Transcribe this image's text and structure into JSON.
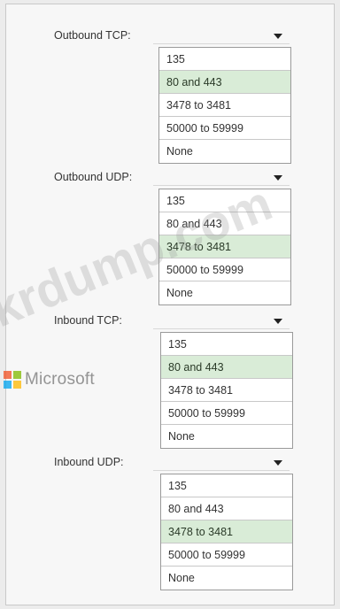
{
  "groups": [
    {
      "label": "Outbound TCP:",
      "options": [
        "135",
        "80 and 443",
        "3478 to 3481",
        "50000 to 59999",
        "None"
      ],
      "selected": "80 and 443"
    },
    {
      "label": "Outbound UDP:",
      "options": [
        "135",
        "80 and 443",
        "3478 to 3481",
        "50000 to 59999",
        "None"
      ],
      "selected": "3478 to 3481"
    },
    {
      "label": "Inbound TCP:",
      "options": [
        "135",
        "80 and 443",
        "3478 to 3481",
        "50000 to 59999",
        "None"
      ],
      "selected": "80 and 443"
    },
    {
      "label": "Inbound UDP:",
      "options": [
        "135",
        "80 and 443",
        "3478 to 3481",
        "50000 to 59999",
        "None"
      ],
      "selected": "3478 to 3481"
    }
  ],
  "watermark": "krdump.com",
  "brand": "Microsoft",
  "colors": {
    "selected_highlight": "#d9ecd7",
    "option_border": "#9a9a9a",
    "background": "#f7f7f7"
  },
  "icons": {
    "dropdown": "chevron-down-icon",
    "brand": "microsoft-logo-icon"
  }
}
